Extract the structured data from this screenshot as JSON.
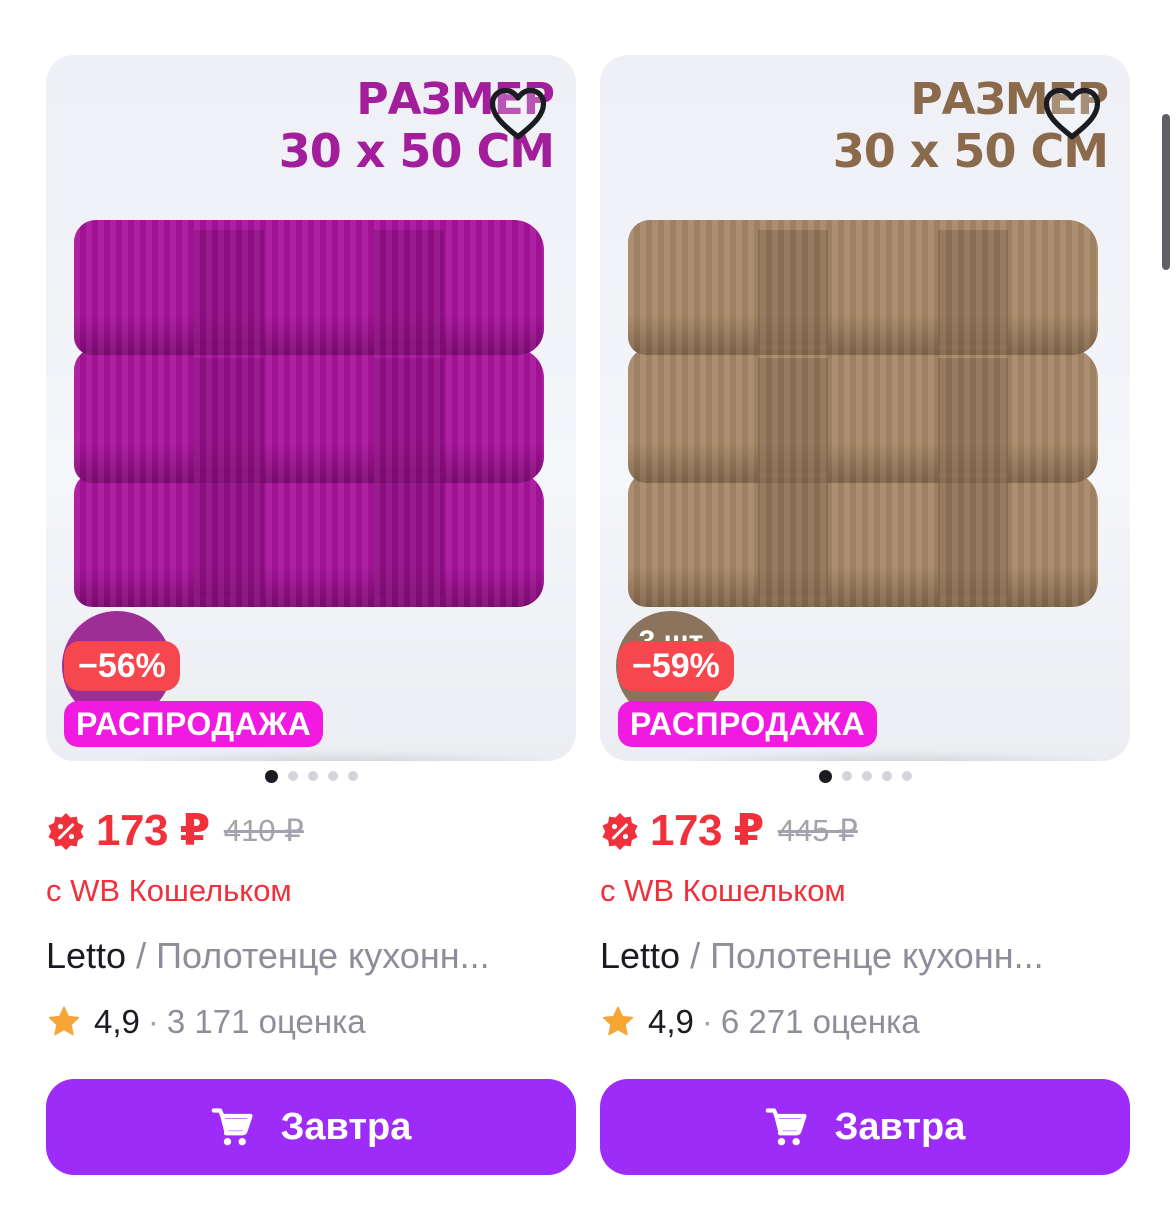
{
  "accent": "#9d2cf9",
  "price_color": "#f0313b",
  "products": [
    {
      "size_line1": "РАЗМЕР",
      "size_line2": "30 x 50 СМ",
      "size_color": "#a21e9a",
      "towel_color": "#a8139c",
      "towel_shade": "#7f0b74",
      "circle_color": "#9c2e96",
      "circle_text": "",
      "discount": "−56%",
      "sale_badge": "РАСПРОДАЖА",
      "image_count": 5,
      "active_image": 1,
      "price": "173 ₽",
      "old_price": "410 ₽",
      "wallet_note": "с WB Кошельком",
      "brand": "Letto",
      "title_rest": " / Полотенце кухонн...",
      "rating": "4,9",
      "reviews": "3 171 оценка",
      "button_label": "Завтра",
      "icons": [
        "heart-icon",
        "discount-percent-icon",
        "star-icon",
        "cart-icon"
      ]
    },
    {
      "size_line1": "РАЗМЕР",
      "size_line2": "30 x 50 СМ",
      "size_color": "#8b6a4b",
      "towel_color": "#a78867",
      "towel_shade": "#80654a",
      "circle_color": "#8b735e",
      "circle_text": "3 шт",
      "discount": "−59%",
      "sale_badge": "РАСПРОДАЖА",
      "image_count": 5,
      "active_image": 1,
      "price": "173 ₽",
      "old_price": "445 ₽",
      "wallet_note": "с WB Кошельком",
      "brand": "Letto",
      "title_rest": " / Полотенце кухонн...",
      "rating": "4,9",
      "reviews": "6 271 оценка",
      "button_label": "Завтра",
      "icons": [
        "heart-icon",
        "discount-percent-icon",
        "star-icon",
        "cart-icon"
      ]
    }
  ]
}
